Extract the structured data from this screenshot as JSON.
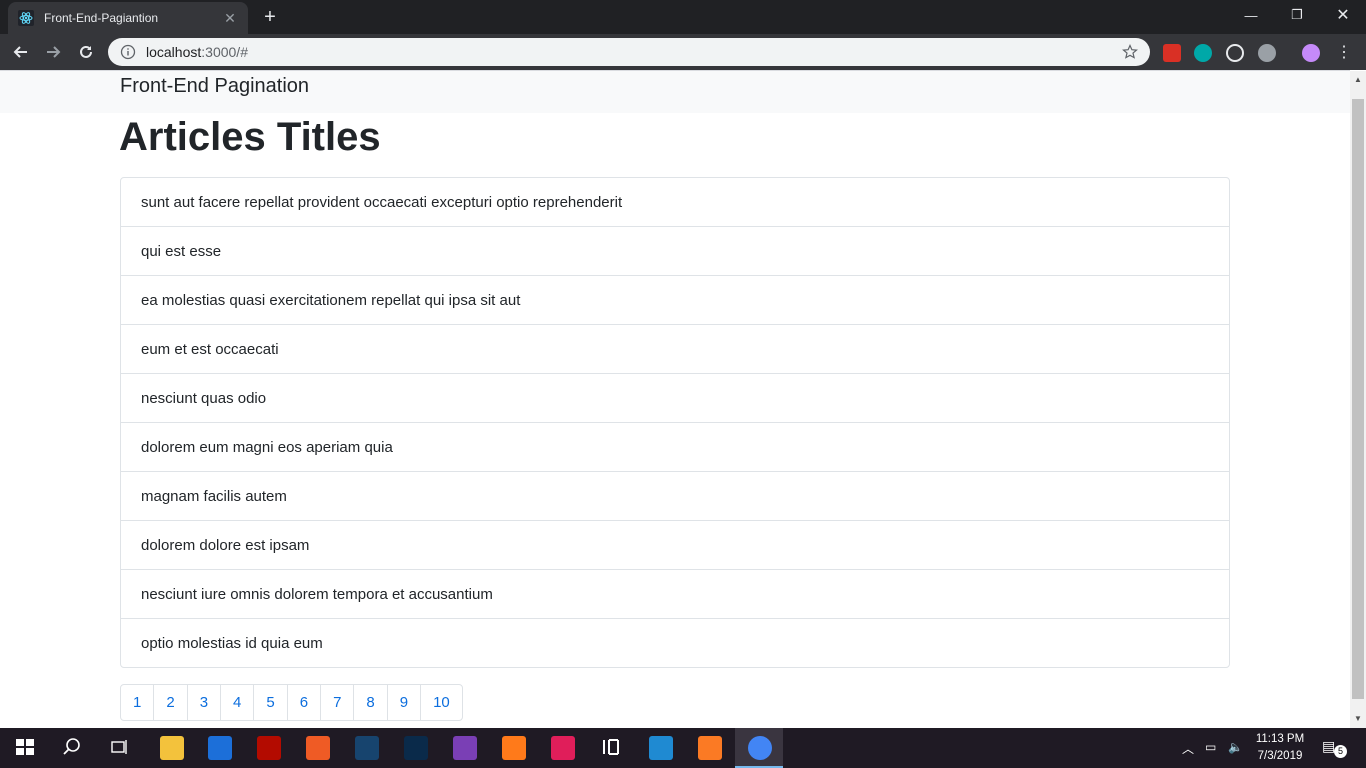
{
  "browser": {
    "tab_title": "Front-End-Pagiantion",
    "url_host": "localhost",
    "url_rest": ":3000/#",
    "colors": {
      "tabbar": "#202124",
      "toolbar": "#35363a",
      "omnibox": "#f1f3f4"
    }
  },
  "navbar": {
    "brand": "Front-End Pagination"
  },
  "main": {
    "heading": "Articles Titles",
    "articles": [
      "sunt aut facere repellat provident occaecati excepturi optio reprehenderit",
      "qui est esse",
      "ea molestias quasi exercitationem repellat qui ipsa sit aut",
      "eum et est occaecati",
      "nesciunt quas odio",
      "dolorem eum magni eos aperiam quia",
      "magnam facilis autem",
      "dolorem dolore est ipsam",
      "nesciunt iure omnis dolorem tempora et accusantium",
      "optio molestias id quia eum"
    ],
    "pagination": [
      "1",
      "2",
      "3",
      "4",
      "5",
      "6",
      "7",
      "8",
      "9",
      "10"
    ],
    "link_color": "#0c6ede"
  },
  "taskbar": {
    "time": "11:13 PM",
    "date": "7/3/2019",
    "notification_count": "5",
    "apps": [
      "start-icon",
      "search-icon",
      "task-view-icon",
      "file-explorer-icon",
      "security-icon",
      "acrobat-icon",
      "postman-icon",
      "mysql-workbench-icon",
      "photoshop-icon",
      "visual-studio-icon",
      "firefox-icon",
      "slack-icon",
      "figma-icon",
      "vscode-icon",
      "xampp-icon",
      "chrome-icon"
    ]
  }
}
